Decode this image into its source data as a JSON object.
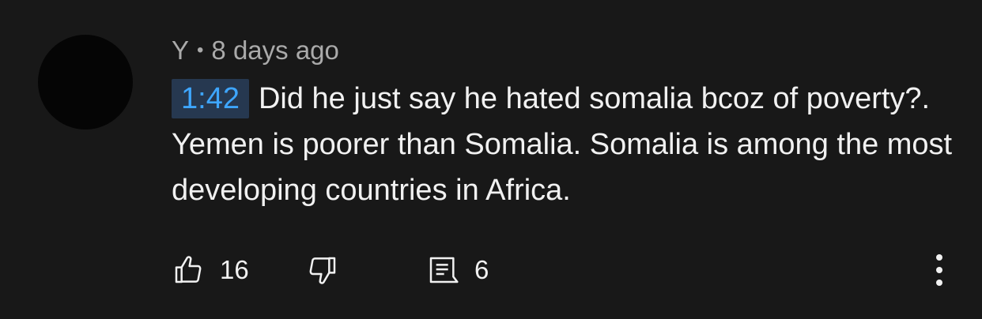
{
  "comment": {
    "author": "Y",
    "separator": "•",
    "age": "8 days ago",
    "timestamp": "1:42",
    "text": "Did he just say he hated somalia bcoz of poverty?. Yemen is poorer than Somalia. Somalia is among the most developing countries in Africa.",
    "likes": "16",
    "replies": "6"
  },
  "icons": {
    "like": "thumbs-up-icon",
    "dislike": "thumbs-down-icon",
    "reply": "comment-icon",
    "more": "more-vertical-icon"
  },
  "colors": {
    "background": "#181818",
    "text": "#f1f1f1",
    "meta": "#aaaaaa",
    "timestamp_text": "#3ea6ff",
    "timestamp_bg": "#263850"
  }
}
